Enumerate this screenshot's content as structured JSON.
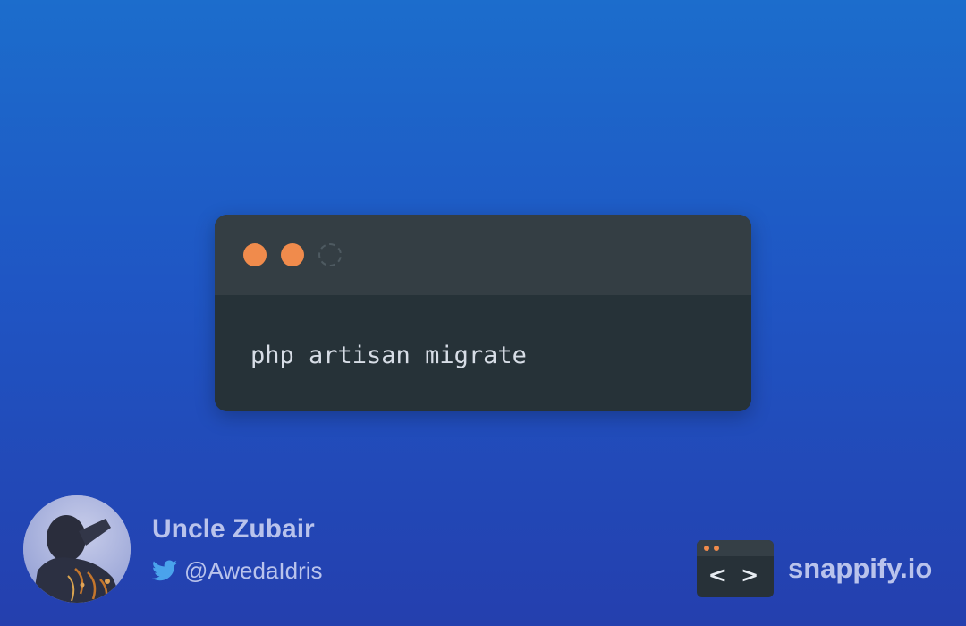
{
  "code_window": {
    "controls": [
      "orange-dot",
      "orange-dot",
      "dashed-circle"
    ],
    "code": "php artisan migrate"
  },
  "author": {
    "name": "Uncle Zubair",
    "handle": "@AwedaIdris",
    "handle_icon": "twitter-bird-icon",
    "avatar": "profile-photo"
  },
  "brand": {
    "name": "snappify.io",
    "logo_symbol": "< >"
  },
  "colors": {
    "background_top": "#1c6dcc",
    "background_bottom": "#243fae",
    "window_body": "#263238",
    "window_titlebar": "#343e44",
    "dot_accent": "#f08b4c",
    "code_text": "#d7dde6",
    "footer_text": "#b9c3ec"
  }
}
